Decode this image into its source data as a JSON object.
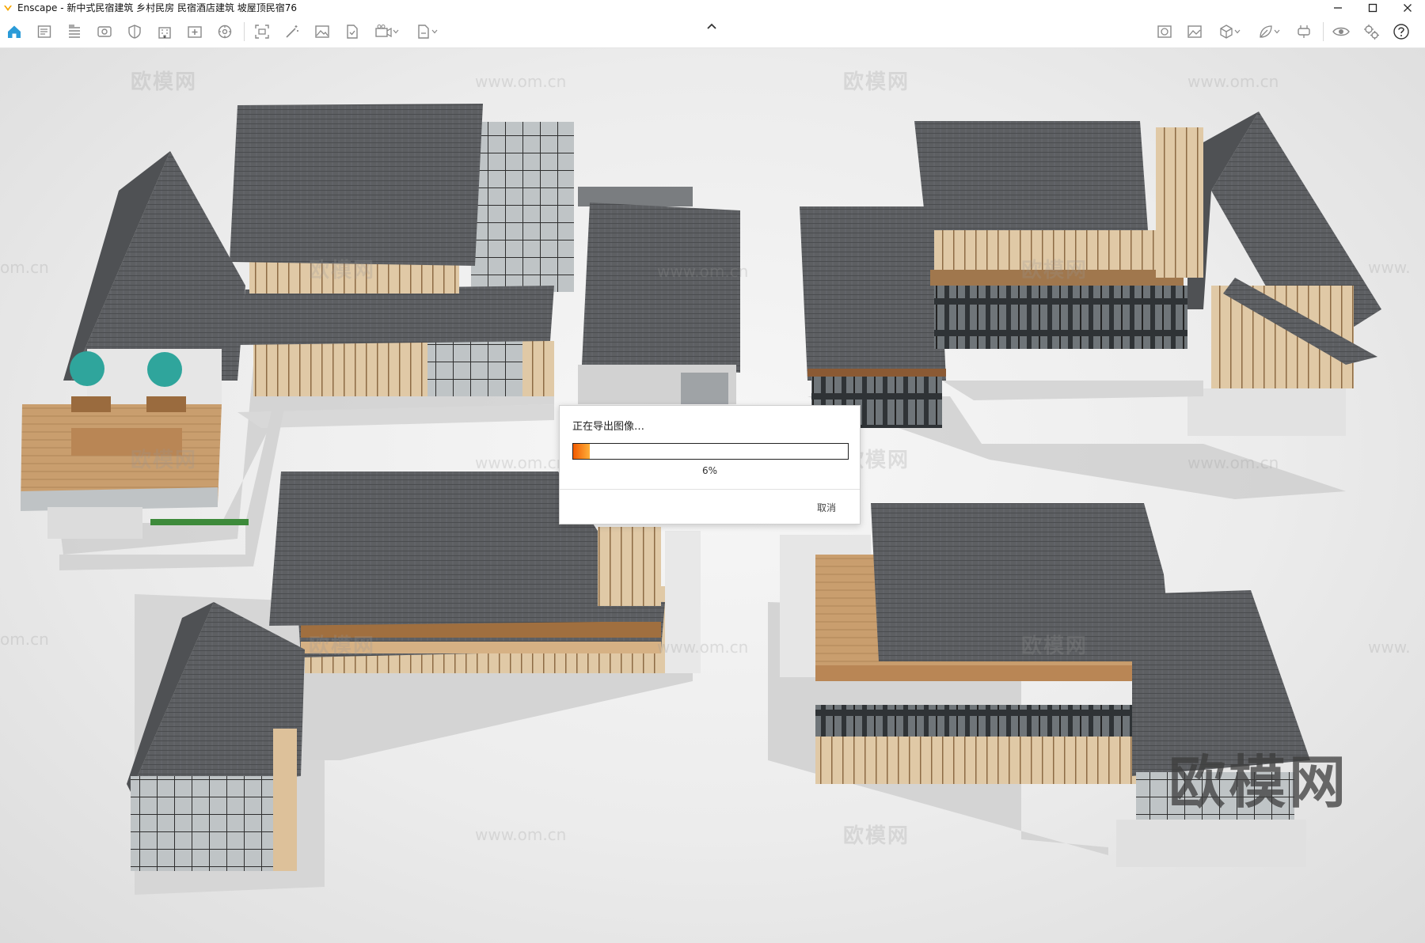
{
  "window": {
    "title": "Enscape - 新中式民宿建筑 乡村民房 民宿酒店建筑 坡屋顶民宿76",
    "controls": [
      "minimize-icon",
      "maximize-icon",
      "close-icon"
    ]
  },
  "toolbar": {
    "left_icons": [
      "home-icon",
      "notes-icon",
      "bim-icon",
      "view-icon",
      "shield-icon",
      "building-icon",
      "asset-add-icon",
      "settings-wheel-icon",
      "screenshot-icon",
      "magic-wand-icon",
      "image-icon",
      "file-check-icon",
      "video-camera-icon",
      "export-file-icon"
    ],
    "right_icons": [
      "panorama-icon",
      "gallery-icon",
      "cube-icon",
      "leaf-icon",
      "vr-headset-icon",
      "eye-icon",
      "gears-icon",
      "help-icon"
    ]
  },
  "dialog": {
    "message": "正在导出图像…",
    "progress": 0.06,
    "progress_text": "6%",
    "cancel_label": "取消",
    "accent_color": "#f15a00"
  },
  "watermarks": {
    "site_name": "欧模网",
    "site_url": "www.om.cn",
    "url_fragment": "om.cn",
    "url_fragment_right": "www."
  }
}
